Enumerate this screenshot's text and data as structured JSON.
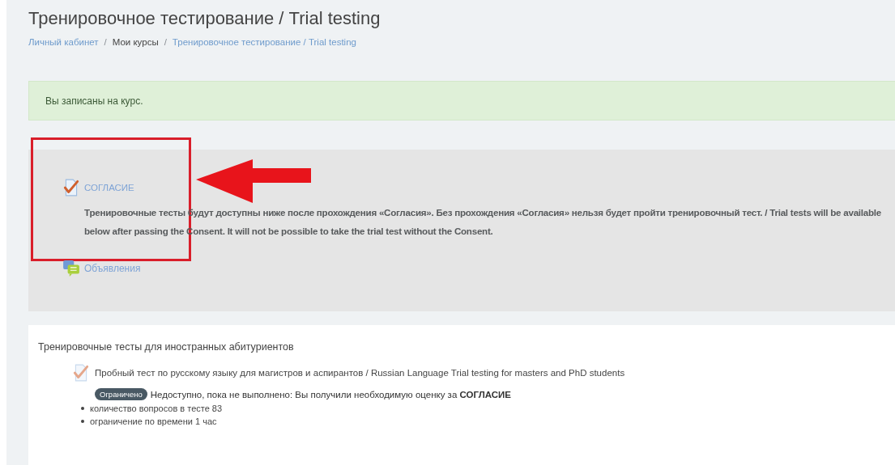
{
  "page_title": "Тренировочное тестирование / Trial testing",
  "breadcrumb": [
    {
      "label": "Личный кабинет",
      "kind": "link"
    },
    {
      "label": "Мои курсы",
      "kind": "plain"
    },
    {
      "label": "Тренировочное тестирование / Trial testing",
      "kind": "link"
    }
  ],
  "breadcrumb_separator": "/",
  "alert": "Вы записаны на курс.",
  "top_section": {
    "activities": [
      {
        "kind": "quiz",
        "label": "СОГЛАСИЕ",
        "description": "Тренировочные тесты будут доступны ниже после прохождения «Согласия». Без прохождения «Согласия» нельзя будет пройти тренировочный тест. / Trial tests will be available below after passing the Consent. It will not be possible to take the trial test without the Consent."
      },
      {
        "kind": "forum",
        "label": "Объявления"
      }
    ]
  },
  "course_section": {
    "title": "Тренировочные тесты для иностранных абитуриентов",
    "activity": {
      "label": "Пробный тест по русскому языку для магистров и аспирантов / Russian Language Trial testing for masters and PhD students",
      "badge": "Ограничено",
      "restriction": "Недоступно, пока не выполнено: Вы получили необходимую оценку за **СОГЛАСИЕ**",
      "details": [
        "количество вопросов в тесте 83",
        "ограничение по времени 1 час"
      ]
    }
  }
}
